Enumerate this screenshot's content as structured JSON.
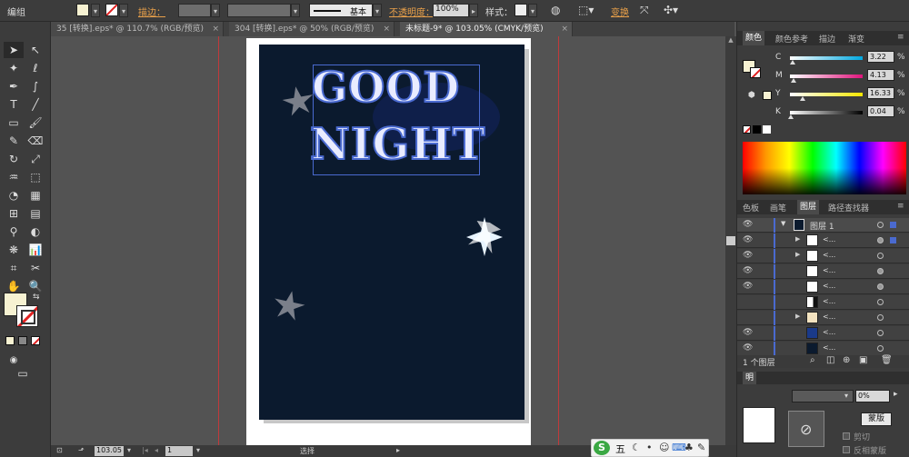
{
  "topbar": {
    "mode": "编组",
    "stroke_label": "描边：",
    "stroke_style": "基本",
    "opacity_label": "不透明度：",
    "opacity_value": "100%",
    "style_label": "样式：",
    "transform_label": "变换"
  },
  "tabs": [
    {
      "label": "35 [转换].eps* @ 110.7% (RGB/预览)"
    },
    {
      "label": "304 [转换].eps* @ 50% (RGB/预览)"
    },
    {
      "label": "未标题-9* @ 103.05% (CMYK/预览)"
    }
  ],
  "artwork": {
    "line1": "GOOD",
    "line2": "NIGHT"
  },
  "color_panel": {
    "tabs": [
      "颜色",
      "颜色参考",
      "描边",
      "渐变"
    ],
    "channels": [
      {
        "label": "C",
        "value": "3.22",
        "unit": "%"
      },
      {
        "label": "M",
        "value": "4.13",
        "unit": "%"
      },
      {
        "label": "Y",
        "value": "16.33",
        "unit": "%"
      },
      {
        "label": "K",
        "value": "0.04",
        "unit": "%"
      }
    ]
  },
  "layers_panel": {
    "tabs": [
      "色板",
      "画笔",
      "图层",
      "路径查找器"
    ],
    "top_layer": "图层 1",
    "sublayer_label": "<...",
    "count_label": "1 个图层"
  },
  "transparency_panel": {
    "mode_short": "明",
    "opacity": "0%",
    "make_mask": "蒙版",
    "clip": "剪切",
    "invert": "反相蒙版"
  },
  "status": {
    "zoom": "103.05",
    "page": "1",
    "tool": "选择"
  },
  "taskbar": {
    "ime": "五"
  },
  "colors": {
    "fill": "#f7f2d2",
    "artboard_bg": "#0b1a2e",
    "text_blue": "#4a6ad0"
  }
}
